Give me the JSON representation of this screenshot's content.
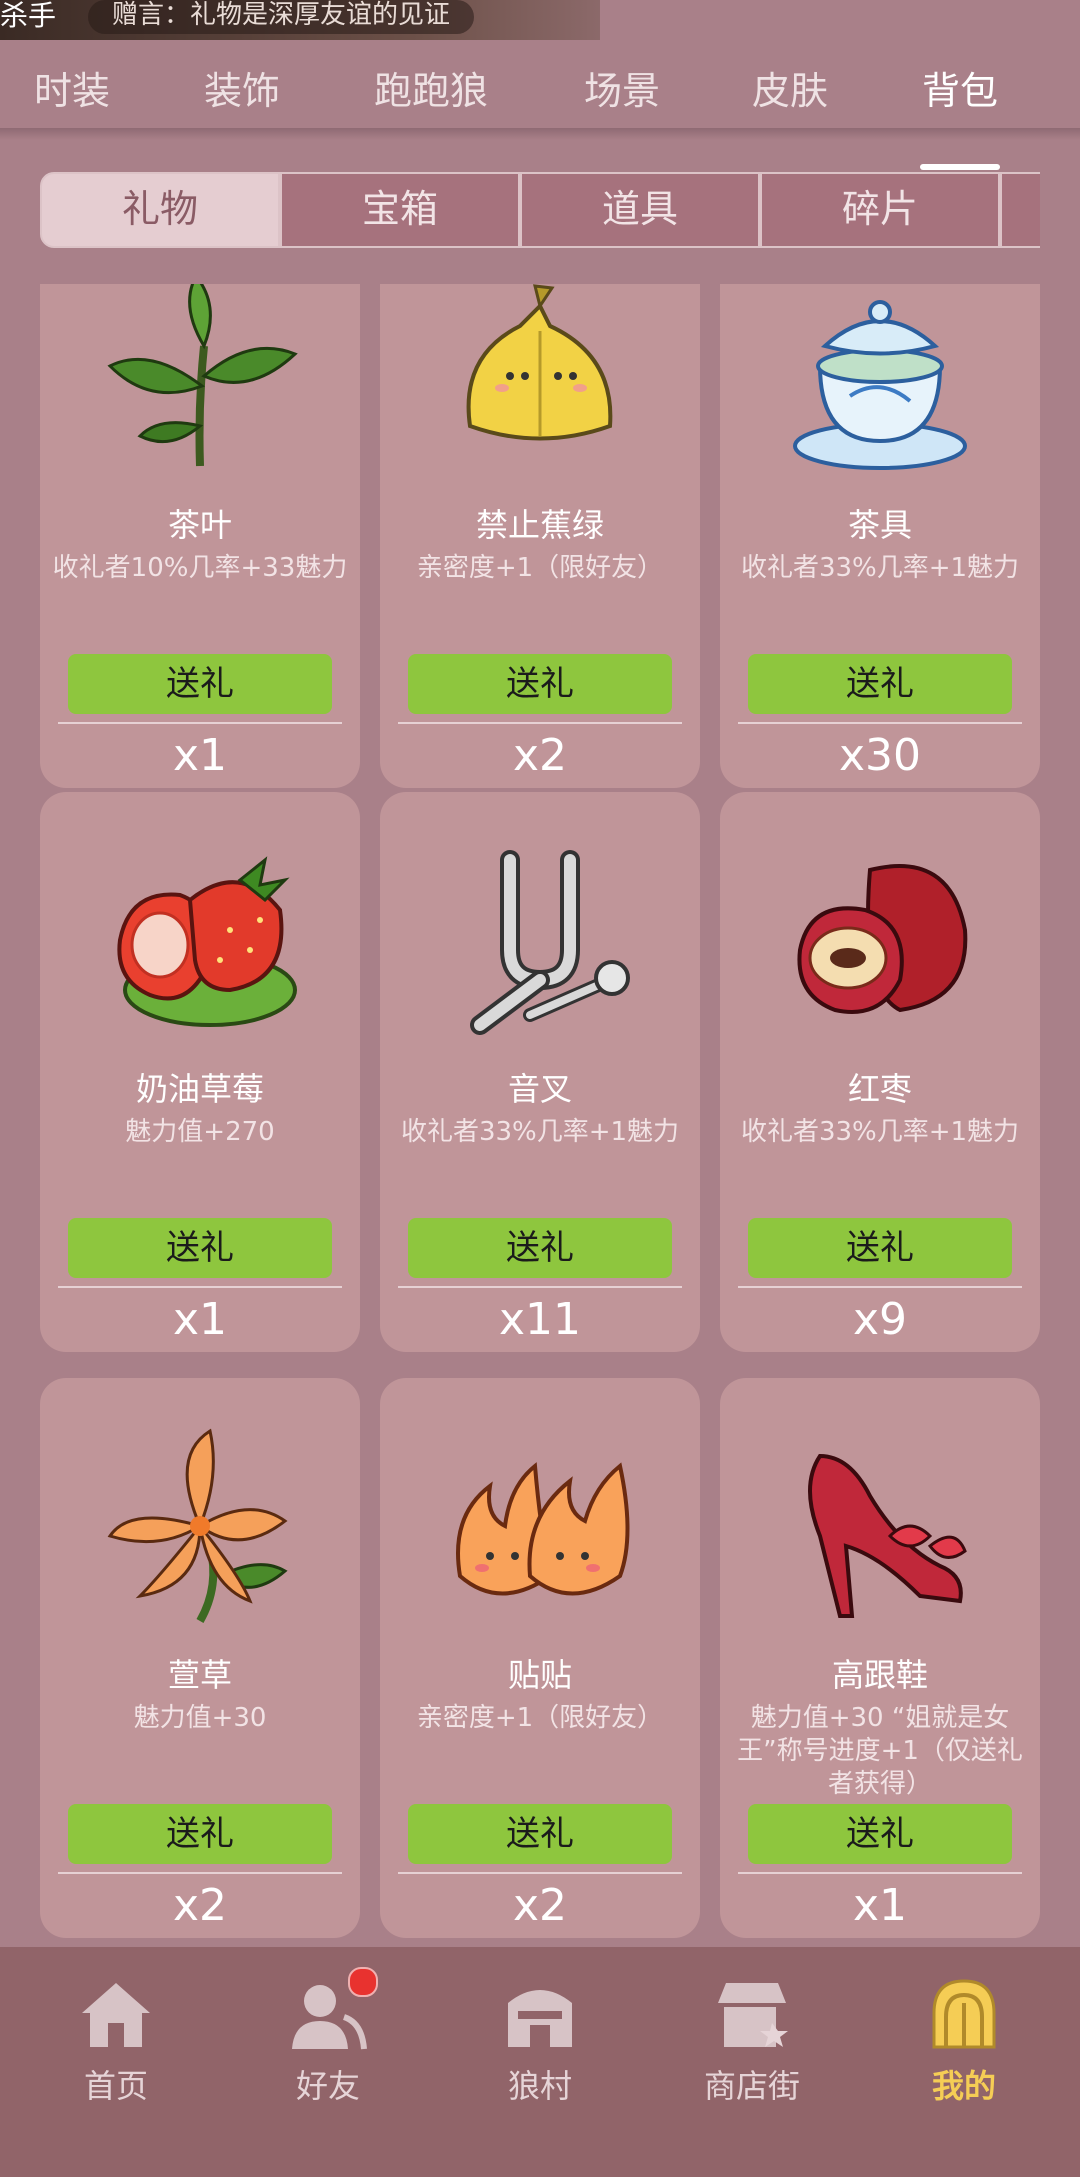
{
  "topbar": {
    "user_fragment": "杀手",
    "gift_message": "赠言：礼物是深厚友谊的见证"
  },
  "nav": {
    "tabs": [
      "时装",
      "装饰",
      "跑跑狼",
      "场景",
      "皮肤",
      "背包"
    ],
    "active": "背包"
  },
  "subtabs": {
    "items": [
      "礼物",
      "宝箱",
      "道具",
      "碎片"
    ],
    "active": "礼物"
  },
  "send_label": "送礼",
  "items": [
    {
      "name": "茶叶",
      "desc": "收礼者10%几率+33魅力",
      "qty": "x1",
      "icon": "tea-leaf-icon"
    },
    {
      "name": "禁止蕉绿",
      "desc": "亲密度+1（限好友）",
      "qty": "x2",
      "icon": "banana-icon"
    },
    {
      "name": "茶具",
      "desc": "收礼者33%几率+1魅力",
      "qty": "x30",
      "icon": "tea-set-icon"
    },
    {
      "name": "奶油草莓",
      "desc": "魅力值+270",
      "qty": "x1",
      "icon": "strawberry-icon"
    },
    {
      "name": "音叉",
      "desc": "收礼者33%几率+1魅力",
      "qty": "x11",
      "icon": "tuning-fork-icon"
    },
    {
      "name": "红枣",
      "desc": "收礼者33%几率+1魅力",
      "qty": "x9",
      "icon": "red-date-icon"
    },
    {
      "name": "萱草",
      "desc": "魅力值+30",
      "qty": "x2",
      "icon": "daylily-icon"
    },
    {
      "name": "贴贴",
      "desc": "亲密度+1（限好友）",
      "qty": "x2",
      "icon": "flames-icon"
    },
    {
      "name": "高跟鞋",
      "desc": "魅力值+30 “姐就是女王”称号进度+1（仅送礼者获得）",
      "qty": "x1",
      "icon": "high-heel-icon"
    }
  ],
  "bottom_nav": {
    "items": [
      "首页",
      "好友",
      "狼村",
      "商店街",
      "我的"
    ],
    "active": "我的"
  },
  "colors": {
    "send_button": "#8ec63e",
    "active_bottom": "#f5cd55",
    "background": "#a98089"
  }
}
